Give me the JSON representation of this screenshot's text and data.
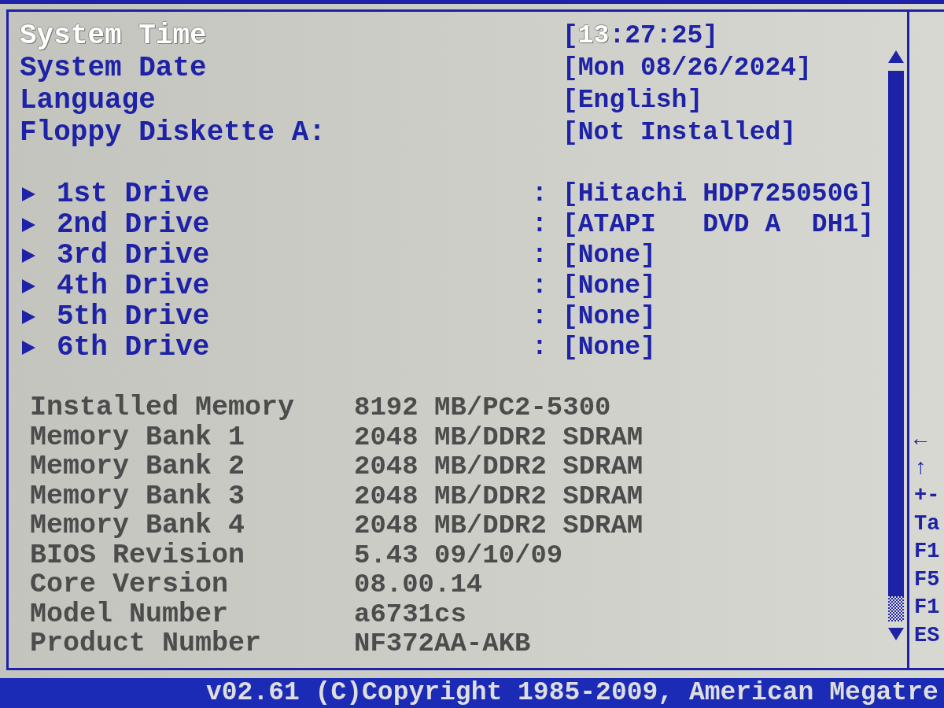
{
  "settings": [
    {
      "label": "System Time",
      "selected": true,
      "value_parts": [
        {
          "text": "[",
          "active": false
        },
        {
          "text": "13",
          "active": true
        },
        {
          "text": ":27:25]",
          "active": false
        }
      ]
    },
    {
      "label": "System Date",
      "selected": false,
      "value_parts": [
        {
          "text": "[Mon 08/26/2024]",
          "active": false
        }
      ]
    },
    {
      "label": "Language",
      "selected": false,
      "value_parts": [
        {
          "text": "[English]",
          "active": false
        }
      ]
    },
    {
      "label": "Floppy Diskette A:",
      "selected": false,
      "value_parts": [
        {
          "text": "[Not Installed]",
          "active": false
        }
      ]
    }
  ],
  "drives": [
    {
      "label": "1st Drive",
      "selected": false,
      "separator": ":",
      "value": "[Hitachi HDP725050G]"
    },
    {
      "label": "2nd Drive",
      "selected": false,
      "separator": ":",
      "value": "[ATAPI   DVD A  DH1]"
    },
    {
      "label": "3rd Drive",
      "selected": false,
      "separator": ":",
      "value": "[None]"
    },
    {
      "label": "4th Drive",
      "selected": false,
      "separator": ":",
      "value": "[None]"
    },
    {
      "label": "5th Drive",
      "selected": false,
      "separator": ":",
      "value": "[None]"
    },
    {
      "label": "6th Drive",
      "selected": false,
      "separator": ":",
      "value": "[None]"
    }
  ],
  "system_info": [
    {
      "label": "Installed Memory",
      "value": "8192 MB/PC2-5300"
    },
    {
      "label": "Memory Bank 1",
      "value": "2048 MB/DDR2 SDRAM"
    },
    {
      "label": "Memory Bank 2",
      "value": "2048 MB/DDR2 SDRAM"
    },
    {
      "label": "Memory Bank 3",
      "value": "2048 MB/DDR2 SDRAM"
    },
    {
      "label": "Memory Bank 4",
      "value": "2048 MB/DDR2 SDRAM"
    },
    {
      "label": "BIOS Revision",
      "value": "5.43 09/10/09"
    },
    {
      "label": "Core Version",
      "value": "08.00.14"
    },
    {
      "label": "Model Number",
      "value": "a6731cs"
    },
    {
      "label": "Product Number",
      "value": "NF372AA-AKB"
    }
  ],
  "help_panel": {
    "key_hints": [
      "←",
      "↑",
      "+-",
      "Ta",
      "F1",
      "F5",
      "F1",
      "ES"
    ]
  },
  "footer": {
    "copyright": "v02.61 (C)Copyright 1985-2009, American Megatre"
  }
}
